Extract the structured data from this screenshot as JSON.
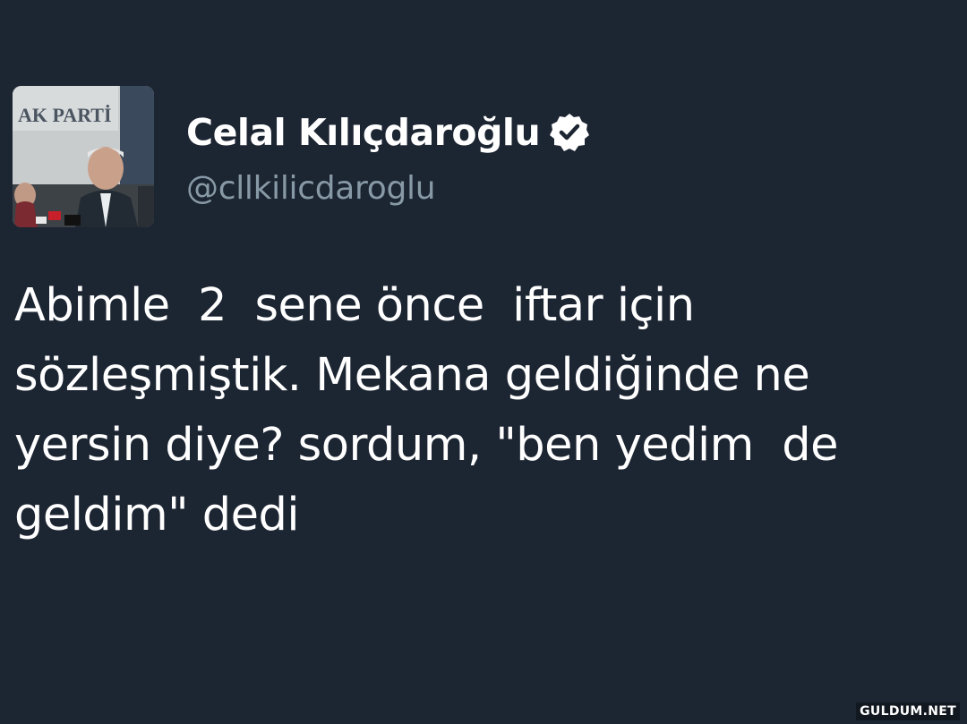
{
  "tweet": {
    "display_name": "Celal Kılıçdaroğlu",
    "handle": "@cllkilicdaroglu",
    "verified": true,
    "avatar_sign_text": "AK PARTİ",
    "text": "Abimle  2  sene önce  iftar için\nsözleşmiştik. Mekana geldiğinde ne\nyersin diye? sordum, \"ben yedim  de\ngeldim\" dedi"
  },
  "watermark": "GULDUM.NET",
  "colors": {
    "background": "#1c2532",
    "name": "#ffffff",
    "handle": "#8899a6",
    "text": "#ffffff"
  },
  "icons": {
    "verified": "verified-badge-icon"
  }
}
